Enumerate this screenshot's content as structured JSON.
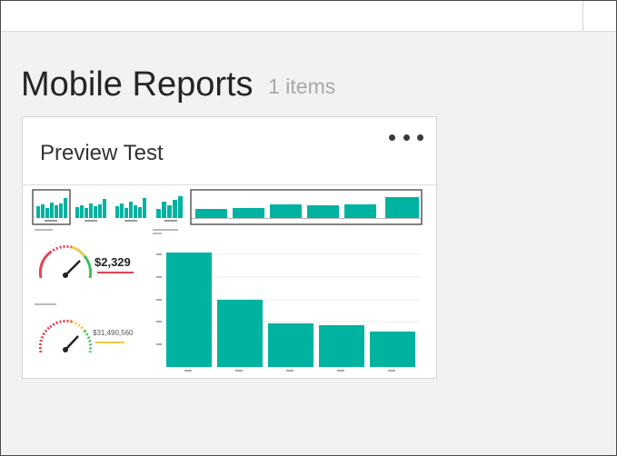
{
  "section": {
    "title": "Mobile Reports",
    "count_label": "1 items"
  },
  "report_tile": {
    "title": "Preview Test",
    "more_icon": "ellipsis-icon",
    "thumbnail": {
      "gauge_values": [
        "$2,329",
        "$31,490,560"
      ],
      "accent_color": "#00b2a0"
    }
  }
}
